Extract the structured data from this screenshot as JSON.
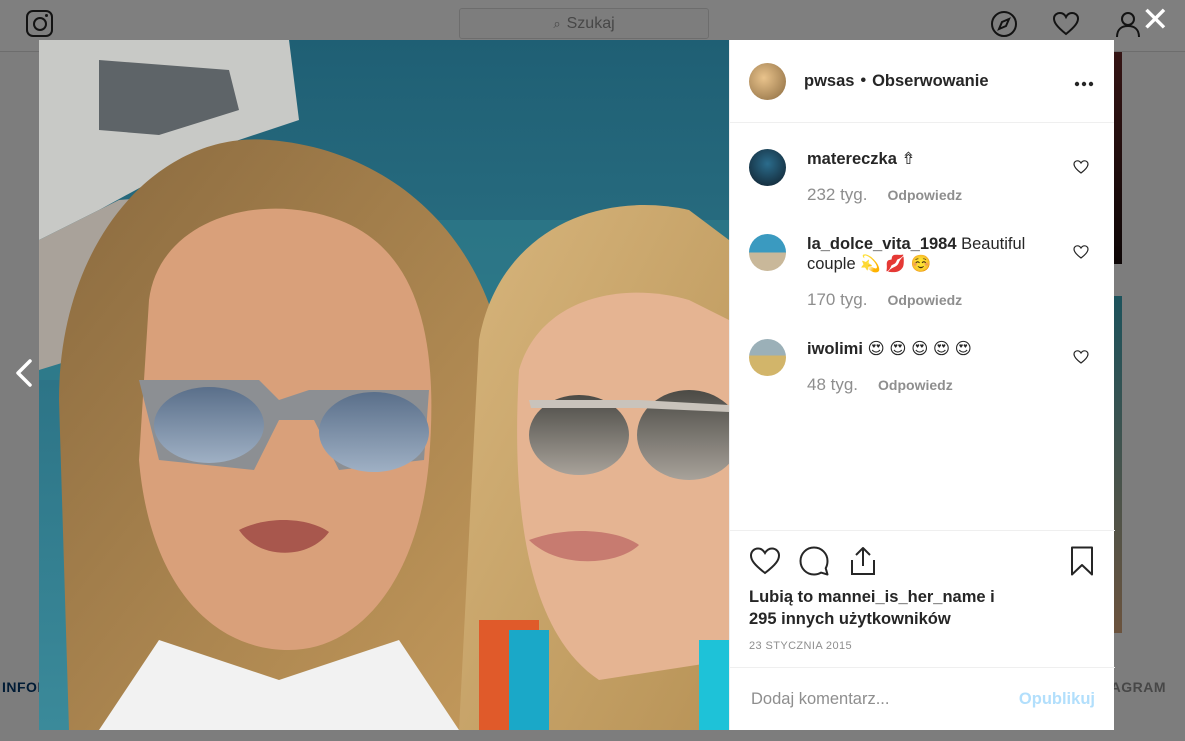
{
  "background": {
    "search_placeholder": "Szukaj",
    "footer_left": "INFOR",
    "footer_right": "TAGRAM"
  },
  "post": {
    "username": "pwsas",
    "separator": "•",
    "follow_label": "Obserwowanie",
    "more_label": "•••"
  },
  "comments": [
    {
      "user": "matereczka",
      "text": "⇮",
      "time": "232 tyg.",
      "reply": "Odpowiedz"
    },
    {
      "user": "la_dolce_vita_1984",
      "text": "Beautiful couple 💫 💋 ☺️",
      "time": "170 tyg.",
      "reply": "Odpowiedz"
    },
    {
      "user": "iwolimi",
      "text": "😍 😍 😍 😍 😍",
      "time": "48 tyg.",
      "reply": "Odpowiedz"
    }
  ],
  "likes": {
    "line1": "Lubią to mannei_is_her_name i",
    "line2": "295 innych użytkowników"
  },
  "date": "23 STYCZNIA 2015",
  "comment_box": {
    "placeholder": "Dodaj komentarz...",
    "publish_label": "Opublikuj"
  },
  "close_label": "✕",
  "colors": {
    "publish_disabled": "#b2dffc",
    "muted_text": "#8e8e8e",
    "text": "#262626"
  }
}
